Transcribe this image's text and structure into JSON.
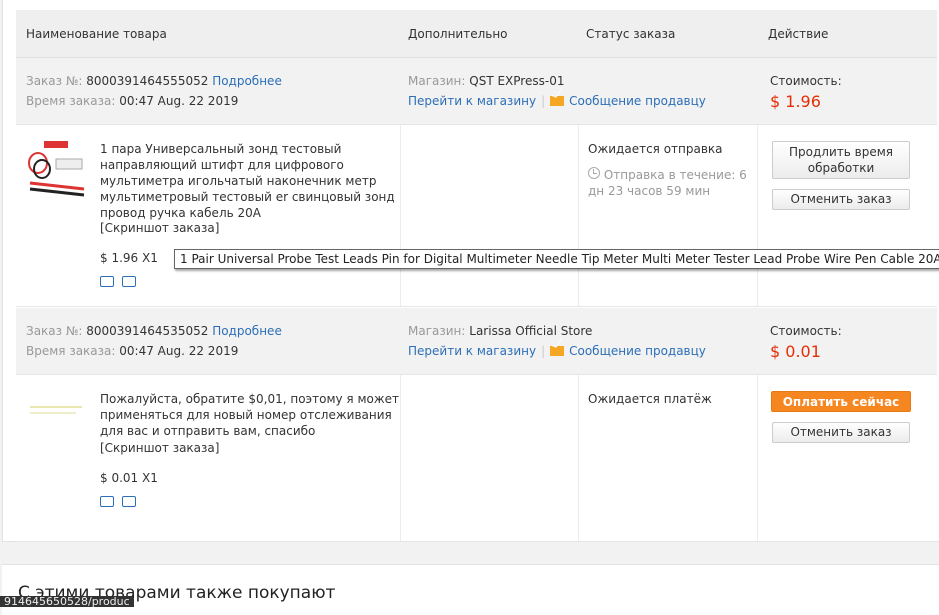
{
  "table": {
    "col_product": "Наименование товара",
    "col_extra": "Дополнительно",
    "col_status": "Статус заказа",
    "col_action": "Действие"
  },
  "orders": [
    {
      "order_label": "Заказ №:",
      "order_no": "8000391464555052",
      "details_link": "Подробнее",
      "time_label": "Время заказа:",
      "time_value": "00:47 Aug. 22 2019",
      "store_label": "Магазин:",
      "store_name": "QST EXPress-01",
      "goto_store": "Перейти к магазину",
      "message_seller": "Сообщение продавцу",
      "cost_label": "Стоимость:",
      "cost_value": "$ 1.96",
      "product_title": "1 пара Универсальный зонд тестовый направляющий штифт для цифрового мультиметра игольчатый наконечник метр мультиметровый тестовый er свинцовый зонд провод ручка кабель 20A",
      "screenshot_link": "[Скриншот заказа]",
      "price_qty": "$ 1.96 X1",
      "status": "Ожидается отправка",
      "status_note": "Отправка в течение: 6 дн 23 часов 59 мин",
      "btn_extend": "Продлить время обработки",
      "btn_cancel": "Отменить заказ"
    },
    {
      "order_label": "Заказ №:",
      "order_no": "8000391464535052",
      "details_link": "Подробнее",
      "time_label": "Время заказа:",
      "time_value": "00:47 Aug. 22 2019",
      "store_label": "Магазин:",
      "store_name": "Larissa Official Store",
      "goto_store": "Перейти к магазину",
      "message_seller": "Сообщение продавцу",
      "cost_label": "Стоимость:",
      "cost_value": "$ 0.01",
      "product_title": "Пожалуйста, обратите $0,01, поэтому я может применяться для новый номер отслеживания для вас и отправить вам, спасибо",
      "screenshot_link": "[Скриншот заказа]",
      "price_qty": "$ 0.01 X1",
      "status": "Ожидается платёж",
      "btn_pay": "Оплатить сейчас",
      "btn_cancel": "Отменить заказ"
    }
  ],
  "tooltip": "1 Pair Universal Probe Test Leads Pin for Digital Multimeter Needle Tip Meter Multi Meter Tester Lead Probe Wire Pen Cable 20A",
  "also_bought": "С этими товарами также покупают",
  "status_url": "914645650528/produc",
  "colors": {
    "link": "#2c6fb7",
    "price": "#e62e04",
    "pay_button": "#f6861f"
  }
}
